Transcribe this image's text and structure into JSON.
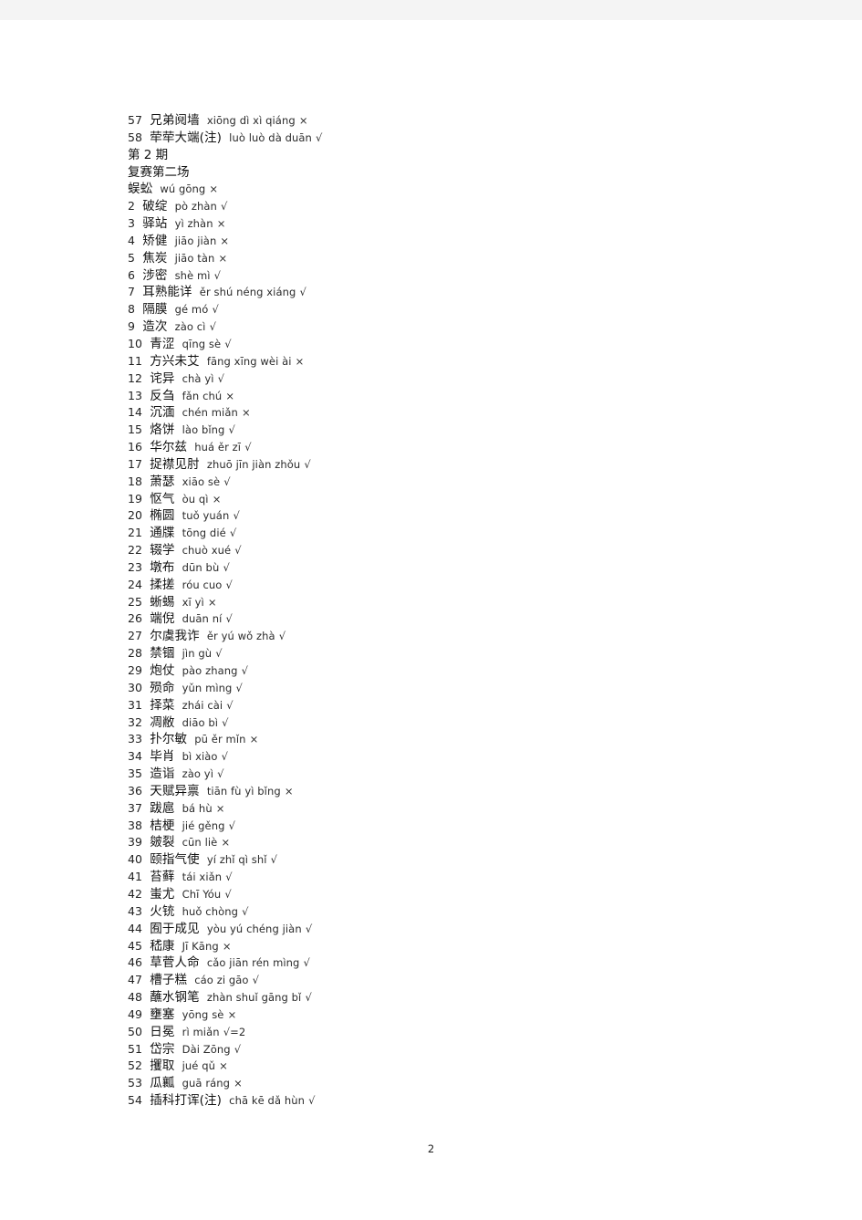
{
  "document": {
    "page_number": "2",
    "background_color": "#ffffff",
    "band_color": "#f4f4f4",
    "text_color": "#1a1a1a"
  },
  "headings": {
    "period": "第 2 期",
    "round": "复赛第二场"
  },
  "entries_before_heading": [
    {
      "num": "57",
      "word": "兄弟阋墙",
      "pinyin": "xiōng dì xì qiáng",
      "mark": "×"
    },
    {
      "num": "58",
      "word": "荦荦大端(注)",
      "pinyin": "luò luò dà duān",
      "mark": "√"
    }
  ],
  "entries": [
    {
      "num": "",
      "word": "蜈蚣",
      "pinyin": "wú gōng",
      "mark": "×"
    },
    {
      "num": "2",
      "word": "破绽",
      "pinyin": "pò zhàn",
      "mark": "√"
    },
    {
      "num": "3",
      "word": "驿站",
      "pinyin": "yì zhàn",
      "mark": "×"
    },
    {
      "num": "4",
      "word": "矫健",
      "pinyin": "jiāo jiàn",
      "mark": "×"
    },
    {
      "num": "5",
      "word": "焦炭",
      "pinyin": "jiāo tàn",
      "mark": "×"
    },
    {
      "num": "6",
      "word": "涉密",
      "pinyin": "shè mì",
      "mark": "√"
    },
    {
      "num": "7",
      "word": "耳熟能详",
      "pinyin": "ěr shú néng xiáng",
      "mark": "√"
    },
    {
      "num": "8",
      "word": "隔膜",
      "pinyin": "gé mó",
      "mark": "√"
    },
    {
      "num": "9",
      "word": "造次",
      "pinyin": "zào cì",
      "mark": "√"
    },
    {
      "num": "10",
      "word": "青涩",
      "pinyin": "qīng sè",
      "mark": "√"
    },
    {
      "num": "11",
      "word": "方兴未艾",
      "pinyin": "fāng xīng wèi ài",
      "mark": "×"
    },
    {
      "num": "12",
      "word": "诧异",
      "pinyin": "chà yì",
      "mark": "√"
    },
    {
      "num": "13",
      "word": "反刍",
      "pinyin": "fǎn chú",
      "mark": "×"
    },
    {
      "num": "14",
      "word": "沉湎",
      "pinyin": "chén miǎn",
      "mark": "×"
    },
    {
      "num": "15",
      "word": "烙饼",
      "pinyin": "lào bǐng",
      "mark": "√"
    },
    {
      "num": "16",
      "word": "华尔兹",
      "pinyin": "huá ěr zī",
      "mark": "√"
    },
    {
      "num": "17",
      "word": "捉襟见肘",
      "pinyin": "zhuō jīn jiàn zhǒu",
      "mark": "√"
    },
    {
      "num": "18",
      "word": "萧瑟",
      "pinyin": "xiāo sè",
      "mark": "√"
    },
    {
      "num": "19",
      "word": "怄气",
      "pinyin": "òu qì",
      "mark": "×"
    },
    {
      "num": "20",
      "word": "椭圆",
      "pinyin": "tuǒ yuán",
      "mark": "√"
    },
    {
      "num": "21",
      "word": "通牒",
      "pinyin": "tōng dié",
      "mark": "√"
    },
    {
      "num": "22",
      "word": "辍学",
      "pinyin": "chuò xué",
      "mark": "√"
    },
    {
      "num": "23",
      "word": "墩布",
      "pinyin": "dūn bù",
      "mark": "√"
    },
    {
      "num": "24",
      "word": "揉搓",
      "pinyin": "róu cuo",
      "mark": "√"
    },
    {
      "num": "25",
      "word": "蜥蜴",
      "pinyin": "xī yì",
      "mark": "×"
    },
    {
      "num": "26",
      "word": "端倪",
      "pinyin": "duān ní",
      "mark": "√"
    },
    {
      "num": "27",
      "word": "尔虞我诈",
      "pinyin": "ěr yú wǒ zhà",
      "mark": "√"
    },
    {
      "num": "28",
      "word": "禁锢",
      "pinyin": "jìn gù",
      "mark": "√"
    },
    {
      "num": "29",
      "word": "炮仗",
      "pinyin": "pào zhang",
      "mark": "√"
    },
    {
      "num": "30",
      "word": "殒命",
      "pinyin": "yǔn mìng",
      "mark": "√"
    },
    {
      "num": "31",
      "word": "择菜",
      "pinyin": "zhái cài",
      "mark": "√"
    },
    {
      "num": "32",
      "word": "凋敝",
      "pinyin": "diāo bì",
      "mark": "√"
    },
    {
      "num": "33",
      "word": "扑尔敏",
      "pinyin": "pū ěr mǐn",
      "mark": "×"
    },
    {
      "num": "34",
      "word": "毕肖",
      "pinyin": "bì xiào",
      "mark": "√"
    },
    {
      "num": "35",
      "word": "造诣",
      "pinyin": "zào yì",
      "mark": "√"
    },
    {
      "num": "36",
      "word": "天赋异禀",
      "pinyin": "tiān fù yì bǐng",
      "mark": "×"
    },
    {
      "num": "37",
      "word": "跋扈",
      "pinyin": "bá hù",
      "mark": "×"
    },
    {
      "num": "38",
      "word": "桔梗",
      "pinyin": "jié gěng",
      "mark": "√"
    },
    {
      "num": "39",
      "word": "皴裂",
      "pinyin": "cūn liè",
      "mark": "×"
    },
    {
      "num": "40",
      "word": "颐指气使",
      "pinyin": "yí zhǐ qì shǐ",
      "mark": "√"
    },
    {
      "num": "41",
      "word": "苔藓",
      "pinyin": "tái xiǎn",
      "mark": "√"
    },
    {
      "num": "42",
      "word": "蚩尤",
      "pinyin": "Chī Yóu",
      "mark": "√"
    },
    {
      "num": "43",
      "word": "火铳",
      "pinyin": "huǒ chòng",
      "mark": "√"
    },
    {
      "num": "44",
      "word": "囿于成见",
      "pinyin": "yòu yú chéng jiàn",
      "mark": "√"
    },
    {
      "num": "45",
      "word": "嵇康",
      "pinyin": "Jī Kāng",
      "mark": "×"
    },
    {
      "num": "46",
      "word": "草菅人命",
      "pinyin": "cǎo jiān rén mìng",
      "mark": "√"
    },
    {
      "num": "47",
      "word": "槽子糕",
      "pinyin": "cáo zi gāo",
      "mark": "√"
    },
    {
      "num": "48",
      "word": "蘸水钢笔",
      "pinyin": "zhàn shuǐ gāng bǐ",
      "mark": "√"
    },
    {
      "num": "49",
      "word": "壅塞",
      "pinyin": "yōng sè",
      "mark": "×"
    },
    {
      "num": "50",
      "word": "日冕",
      "pinyin": "rì miǎn",
      "mark": "√=2"
    },
    {
      "num": "51",
      "word": "岱宗",
      "pinyin": "Dài Zōng",
      "mark": "√"
    },
    {
      "num": "52",
      "word": "攫取",
      "pinyin": "jué qǔ",
      "mark": "×"
    },
    {
      "num": "53",
      "word": "瓜瓤",
      "pinyin": "guā ráng",
      "mark": "×"
    },
    {
      "num": "54",
      "word": "插科打诨(注)",
      "pinyin": "chā kē dǎ hùn",
      "mark": "√"
    }
  ]
}
